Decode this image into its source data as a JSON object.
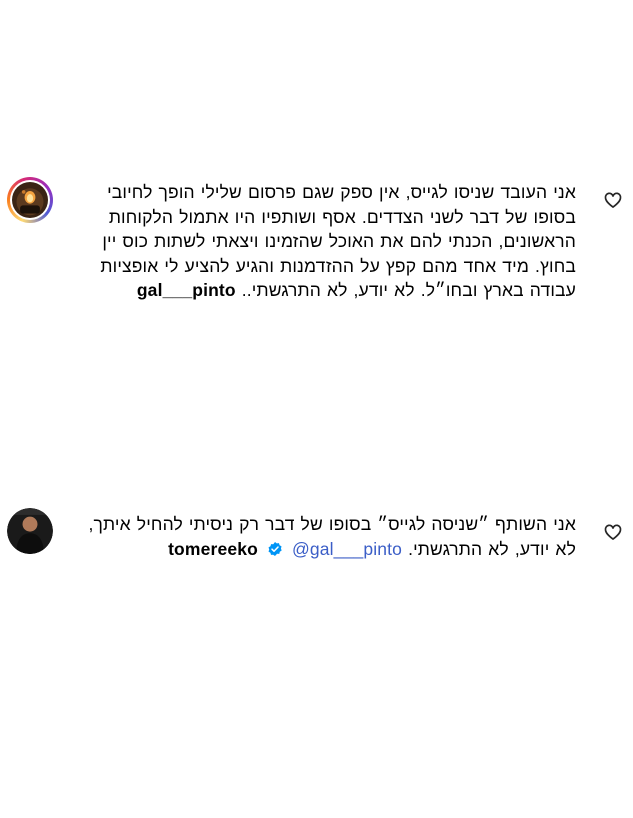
{
  "comments": [
    {
      "username": "gal___pinto",
      "text_before_username": "אני העובד שניסו לגייס, אין ספק שגם פרסום שלילי הופך לחיובי בסופו של דבר לשני הצדדים. אסף ושותפיו היו אתמול הלקוחות הראשונים, הכנתי להם את האוכל שהזמינו ויצאתי לשתות כוס יין בחוץ. מיד אחד מהם קפץ על ההזדמנות והגיע להציע לי אופציות עבודה בארץ ובחו״ל. לא יודע, לא התרגשתי..",
      "avatar_icon": "chef-avatar",
      "like_icon": "heart-outline-icon"
    },
    {
      "username": "tomereeko",
      "verified": true,
      "mention": "@gal___pinto",
      "text": "אני השותף ״שניסה לגייס״ בסופו של דבר רק ניסיתי להחיל איתך, לא יודע, לא התרגשתי.",
      "avatar_icon": "person-avatar",
      "like_icon": "heart-outline-icon"
    }
  ],
  "colors": {
    "mention": "#3b5ec7",
    "verified_badge": "#0095f6",
    "text": "#000000"
  }
}
